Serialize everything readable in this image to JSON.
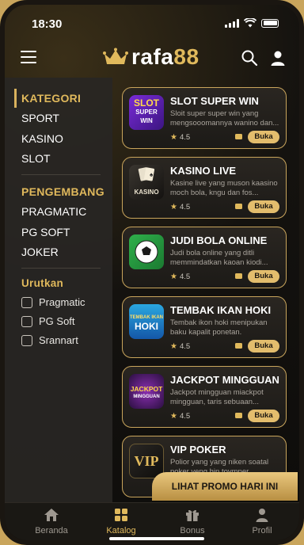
{
  "status": {
    "time": "18:30"
  },
  "brand": {
    "part1": "rafa",
    "part2": "88"
  },
  "sidebar": {
    "kategori_heading": "KATEGORI",
    "kategori_items": [
      "SPORT",
      "KASINO",
      "SLOT"
    ],
    "pengembang_heading": "PENGEMBANG",
    "pengembang_items": [
      "PRAGMATIC",
      "PG SOFT",
      "JOKER"
    ],
    "urutkan_heading": "Urutkan",
    "urutkan_options": [
      "Pragmatic",
      "PG Soft",
      "Srannart"
    ]
  },
  "cards": [
    {
      "title": "SLOT SUPER WIN",
      "desc": "Sloit super super win yang mengsooomannya wanino dan...",
      "rating": "4.5",
      "button": "Buka",
      "thumb_text": [
        "SLOT",
        "SUPER",
        "WIN"
      ]
    },
    {
      "title": "KASINO LIVE",
      "desc": "Kasine live yang muson kaasino moch bola, kngu dan fos...",
      "rating": "4.5",
      "button": "Buka",
      "thumb_text": [
        "KASINO"
      ]
    },
    {
      "title": "JUDI BOLA ONLINE",
      "desc": "Judi bola online yang ditli memmindatkan kaoan kiodi...",
      "rating": "4.5",
      "button": "Buka",
      "thumb_text": []
    },
    {
      "title": "TEMBAK IKAN HOKI",
      "desc": "Tembak ikon hoki menipukan baku kapalit ponetan.",
      "rating": "4.5",
      "button": "Buka",
      "thumb_text": [
        "TEMBAK IKAN",
        "HOKI"
      ]
    },
    {
      "title": "JACKPOT MINGGUAN",
      "desc": "Jackpot mingguan miackpot mingguan, taris sebuaan...",
      "rating": "4.5",
      "button": "Buka",
      "thumb_text": [
        "JACKPOT",
        "MINGGUAN"
      ]
    },
    {
      "title": "VIP POKER",
      "desc": "Polior yang yang niken soatal poker veng hin tovmper",
      "rating": "",
      "button": "",
      "thumb_text": [
        "VIP"
      ]
    }
  ],
  "promo": {
    "label": "LIHAT PROMO HARI INI"
  },
  "bottom_nav": [
    {
      "label": "Beranda",
      "icon": "home-icon"
    },
    {
      "label": "Katalog",
      "icon": "grid-icon"
    },
    {
      "label": "Bonus",
      "icon": "gift-icon"
    },
    {
      "label": "Profil",
      "icon": "user-icon"
    }
  ],
  "colors": {
    "accent": "#e0b95c",
    "background": "#14120f",
    "sidebar": "#282624"
  }
}
